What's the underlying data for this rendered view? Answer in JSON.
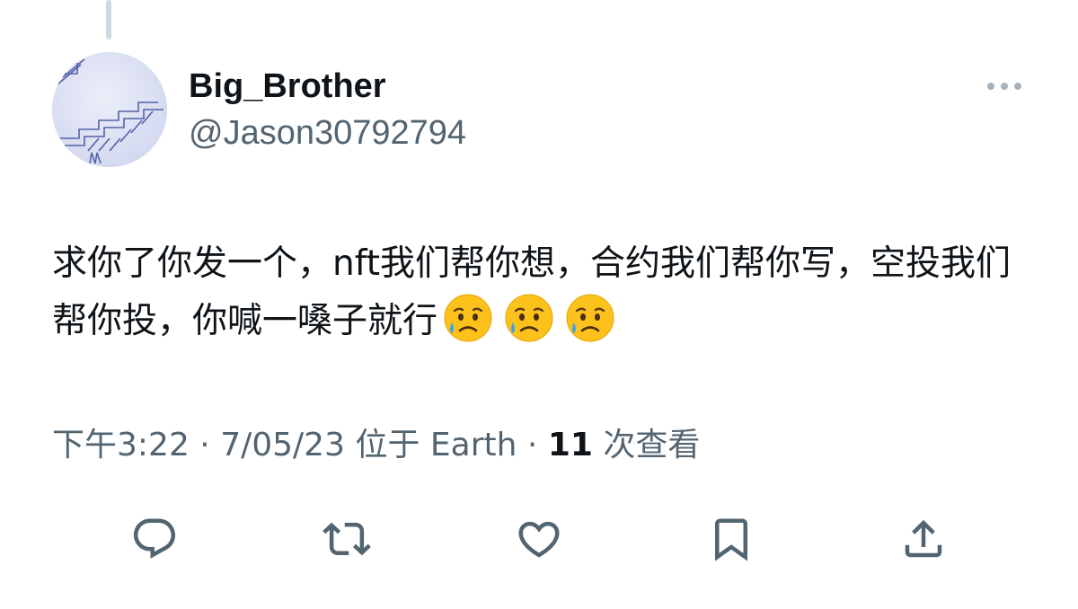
{
  "author": {
    "display_name": "Big_Brother",
    "handle": "@Jason30792794"
  },
  "tweet": {
    "text": "求你了你发一个，nft我们帮你想，合约我们帮你写，空投我们帮你投，你喊一嗓子就行",
    "emojis": [
      "sad-but-relieved-face",
      "sad-but-relieved-face",
      "sad-but-relieved-face"
    ]
  },
  "meta": {
    "time": "下午3:22",
    "separator": "·",
    "date": "7/05/23",
    "location_prefix": "位于",
    "location": "Earth",
    "views_count": "11",
    "views_label": "次查看"
  },
  "icons": {
    "reply": "reply-icon",
    "retweet": "retweet-icon",
    "like": "heart-icon",
    "bookmark": "bookmark-icon",
    "share": "share-icon",
    "more": "more-icon"
  },
  "colors": {
    "text_primary": "#0f1419",
    "text_secondary": "#536471",
    "icon": "#536471"
  }
}
